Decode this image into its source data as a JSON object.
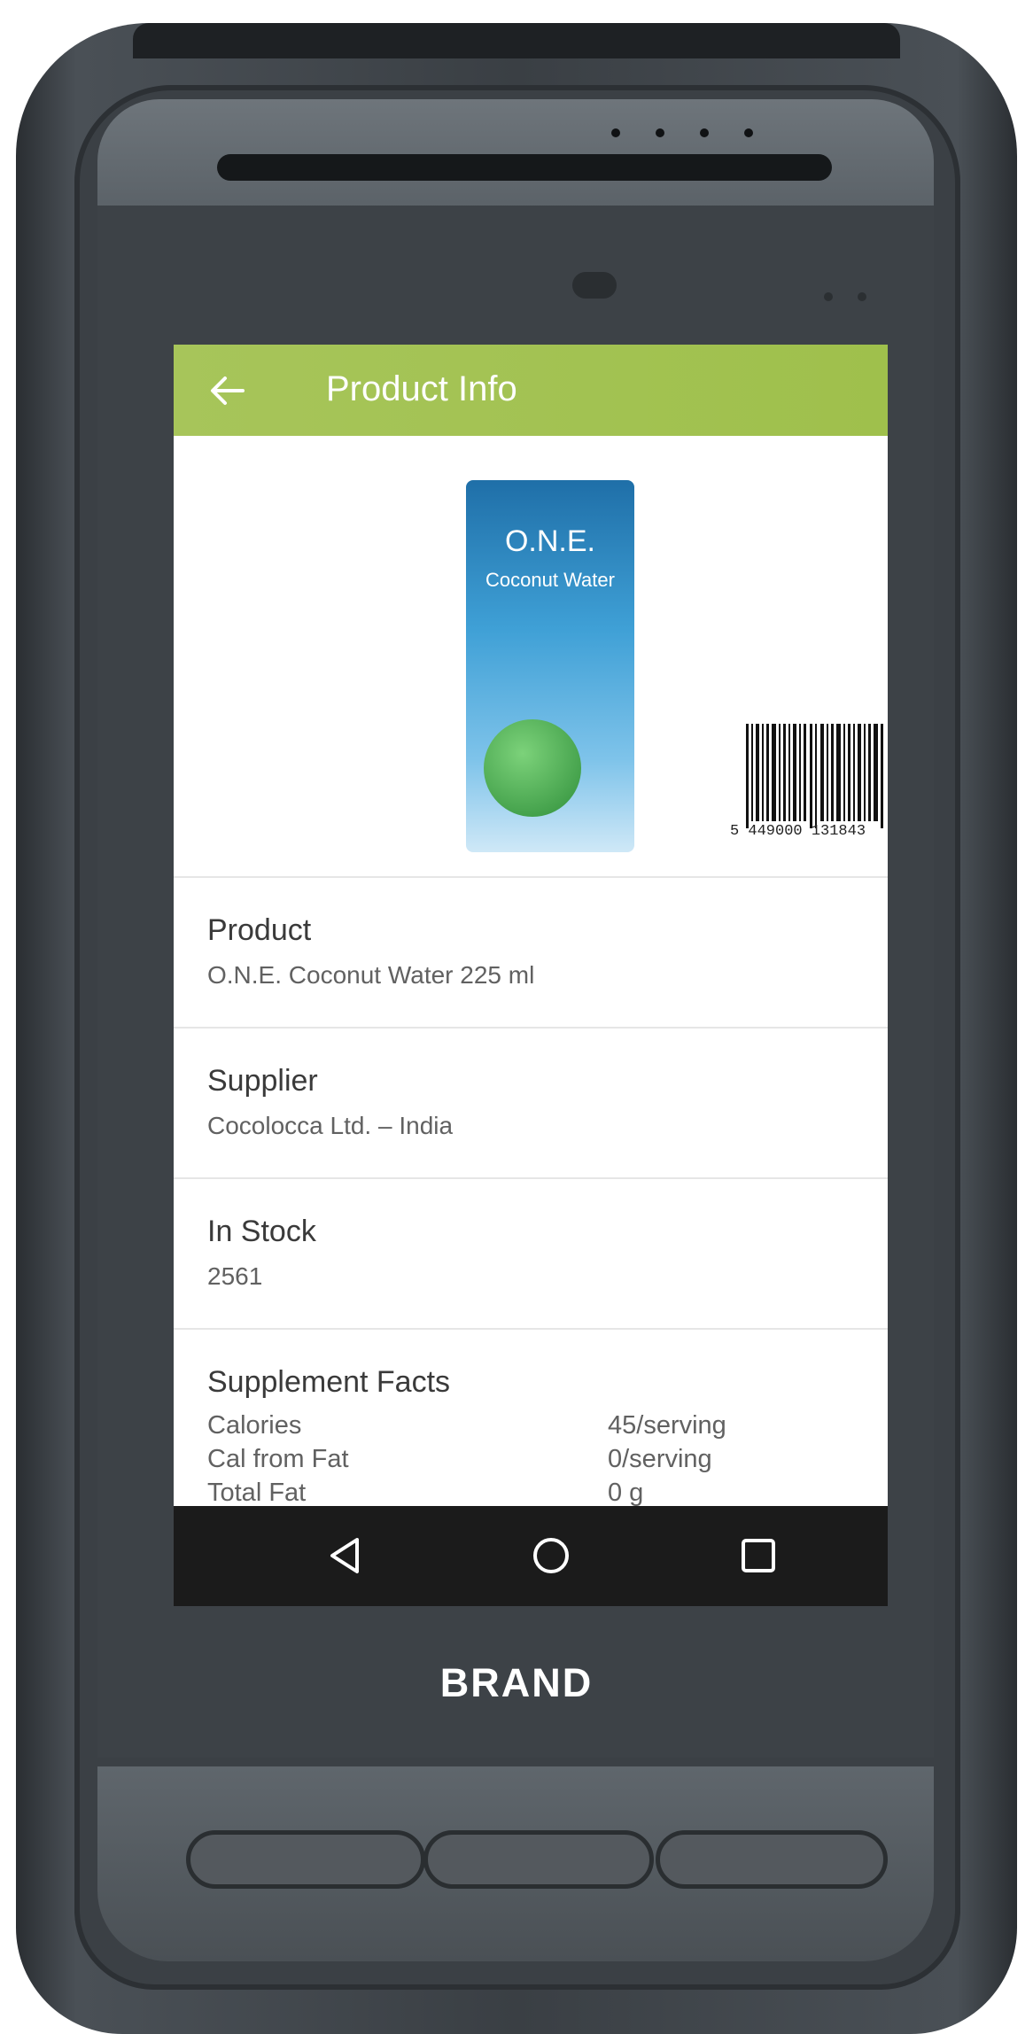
{
  "app_bar": {
    "title": "Product Info",
    "back_icon": "arrow-left-icon",
    "color": "#a3c354"
  },
  "product_image": {
    "carton_brand": "O.N.E.",
    "carton_label": "Coconut Water",
    "barcode_number": "5 449000 131843"
  },
  "details": [
    {
      "label": "Product",
      "value": "O.N.E. Coconut Water 225 ml"
    },
    {
      "label": "Supplier",
      "value": "Cocolocca Ltd. – India"
    },
    {
      "label": "In Stock",
      "value": "2561"
    }
  ],
  "supplement": {
    "label": "Supplement Facts",
    "facts": [
      {
        "name": "Calories",
        "value": "45/serving"
      },
      {
        "name": "Cal from Fat",
        "value": "0/serving"
      },
      {
        "name": "Total Fat",
        "value": "0 g"
      }
    ]
  },
  "nav": {
    "back_icon": "triangle-back-icon",
    "home_icon": "circle-home-icon",
    "recents_icon": "square-recents-icon"
  },
  "device": {
    "brand": "BRAND"
  }
}
